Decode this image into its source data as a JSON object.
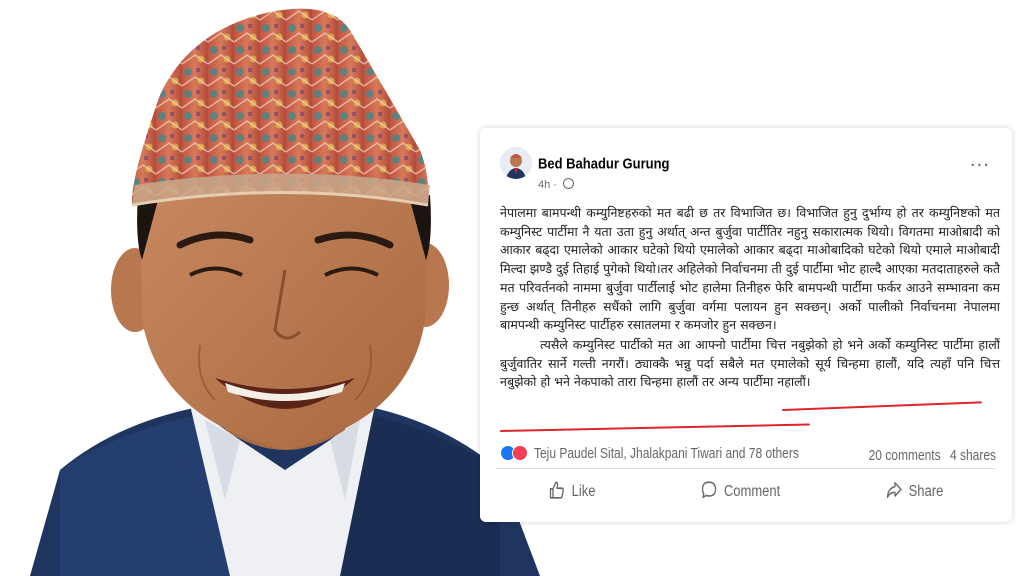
{
  "post": {
    "author": "Bed Bahadur Gurung",
    "time": "4h ·",
    "paragraph_1": "नेपालमा बामपन्थी कम्युनिष्टहरुको मत बढी छ तर विभाजित छ। विभाजित हुनु दुर्भाग्य हो तर कम्युनिष्टको मत कम्युनिस्ट पार्टीमा नै यता उता हुनु अर्थात् अन्त बुर्जुवा पार्टीतिर नहुनु सकारात्मक थियो। विगतमा माओबादी को आकार बढ्दा एमालेको आकार घटेको थियो एमालेको आकार बढ्दा माओबादिको घटेको थियो एमाले माओबादी मिल्दा झण्डै दुई तिहाई पुगेको थियो।तर अहिलेको निर्वाचनमा ती दुई पार्टीमा भोट हाल्दै आएका मतदाताहरुले कतै मत परिवर्तनको नाममा बुर्जुवा पार्टीलाई भोट हालेमा तिनीहरु फेरि बामपन्थी पार्टीमा फर्कर आउने सम्भावना कम हुन्छ अर्थात् तिनीहरु सधैंको लागि बुर्जुवा वर्गमा पलायन हुन सक्छन्। अर्को पालीको निर्वाचनमा नेपालमा बामपन्थी कम्युनिस्ट पार्टीहरु रसातलमा र कमजोर हुन सक्छन।",
    "paragraph_2": "त्यसैले कम्युनिस्ट पार्टीको मत आ आफ्नो पार्टीमा चित्त नबुझेको हो भने अर्को कम्युनिस्ट पार्टीमा हालौं बुर्जुवातिर सार्ने गल्ती नगरौं। ठ्याक्कै भन्नु पर्दा सबैले मत एमालेको सूर्य चिन्हमा हालौं, यदि त्यहाँ पनि चित्त नबुझेको हो भने नेकपाको तारा चिन्हमा हालौं तर अन्य पार्टीमा नहालौं।"
  },
  "reactions": {
    "text": "Teju Paudel Sital, Jhalakpani Tiwari and 78 others",
    "icons": [
      "like-react-icon",
      "love-react-icon"
    ],
    "comments": "20 comments",
    "shares": "4 shares"
  },
  "actions": {
    "like": "Like",
    "comment": "Comment",
    "share": "Share"
  },
  "colors": {
    "underline": "#e0242a",
    "like_blue": "#1877f2",
    "meta_gray": "#65676b"
  }
}
